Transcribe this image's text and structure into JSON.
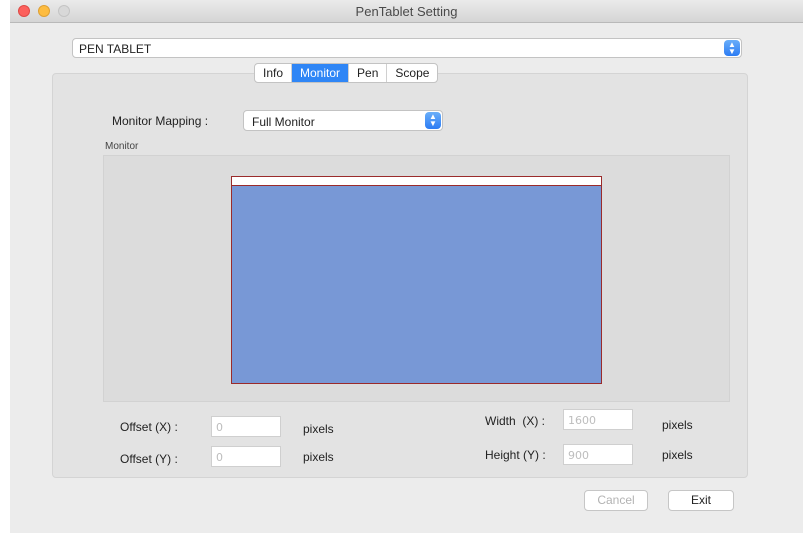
{
  "window": {
    "title": "PenTablet Setting"
  },
  "device_select": {
    "value": "PEN TABLET",
    "stepper_icon": "up-down-chevron-icon"
  },
  "tabs": [
    {
      "label": "Info",
      "active": false
    },
    {
      "label": "Monitor",
      "active": true
    },
    {
      "label": "Pen",
      "active": false
    },
    {
      "label": "Scope",
      "active": false
    }
  ],
  "monitor_mapping": {
    "label": "Monitor Mapping :",
    "value": "Full Monitor",
    "stepper_icon": "up-down-chevron-icon"
  },
  "monitor_area": {
    "caption": "Monitor",
    "screen_color": "#7898d6",
    "border_color": "#9a2b2b"
  },
  "fields": {
    "offset_x": {
      "label": "Offset (X) :",
      "placeholder": "0",
      "unit": "pixels"
    },
    "offset_y": {
      "label": "Offset (Y) :",
      "placeholder": "0",
      "unit": "pixels"
    },
    "width_x": {
      "label": "Width  (X) :",
      "placeholder": "1600",
      "unit": "pixels"
    },
    "height_y": {
      "label": "Height (Y) :",
      "placeholder": "900",
      "unit": "pixels"
    }
  },
  "buttons": {
    "cancel": "Cancel",
    "exit": "Exit"
  },
  "colors": {
    "accent": "#2f86f6",
    "close": "#fc605c",
    "minimize": "#fdbc40"
  }
}
